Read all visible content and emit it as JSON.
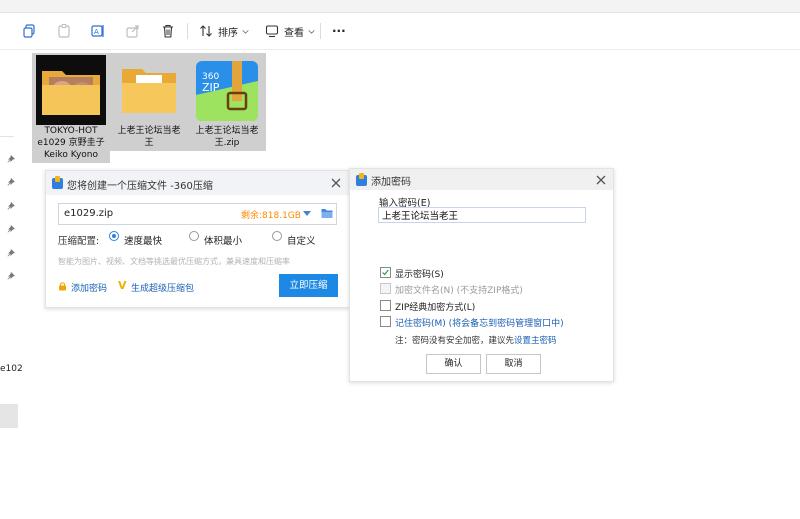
{
  "toolbar": {
    "sort_label": "排序",
    "view_label": "查看",
    "more_label": "···"
  },
  "left_pane": {
    "truncated_item": "e102"
  },
  "files": [
    {
      "name": "TOKYO-HOT e1029 京野圭子 Keiko Kyono",
      "line1": "TOKYO-HOT",
      "line2": "e1029 京野圭子",
      "line3": "Keiko Kyono",
      "icon": "folder-with-thumbnail-icon"
    },
    {
      "name": "上老王论坛当老王",
      "line1": "上老王论坛当老",
      "line2": "王",
      "icon": "folder-icon"
    },
    {
      "name": "上老王论坛当老王.zip",
      "line1": "上老王论坛当老",
      "line2": "王.zip",
      "icon": "360zip-archive-icon",
      "badge_text": "360",
      "badge_sub": "ZIP"
    }
  ],
  "compress_dialog": {
    "title": "您将创建一个压缩文件 -360压缩",
    "filename": "e1029.zip",
    "remaining": "剩余:818.1GB",
    "config_label": "压缩配置:",
    "options": [
      {
        "label": "速度最快",
        "selected": true
      },
      {
        "label": "体积最小",
        "selected": false
      },
      {
        "label": "自定义",
        "selected": false
      }
    ],
    "hint": "智能为图片、视频、文档等挑选最优压缩方式，兼具速度和压缩率",
    "add_password": "添加密码",
    "super_compress": "生成超级压缩包",
    "compress_button": "立即压缩"
  },
  "password_dialog": {
    "title": "添加密码",
    "input_label": "输入密码(E)",
    "password_value": "上老王论坛当老王",
    "options": [
      {
        "label": "显示密码(S)",
        "checked": true,
        "disabled": false
      },
      {
        "label": "加密文件名(N) (不支持ZIP格式)",
        "checked": false,
        "disabled": true
      },
      {
        "label": "ZIP经典加密方式(L)",
        "checked": false,
        "disabled": false
      },
      {
        "label": "记住密码(M) (将会备忘到密码管理窗口中)",
        "checked": false,
        "disabled": false
      }
    ],
    "note_prefix": "注：密码没有安全加密，建议先",
    "note_link": "设置主密码",
    "ok_button": "确认",
    "cancel_button": "取消"
  }
}
